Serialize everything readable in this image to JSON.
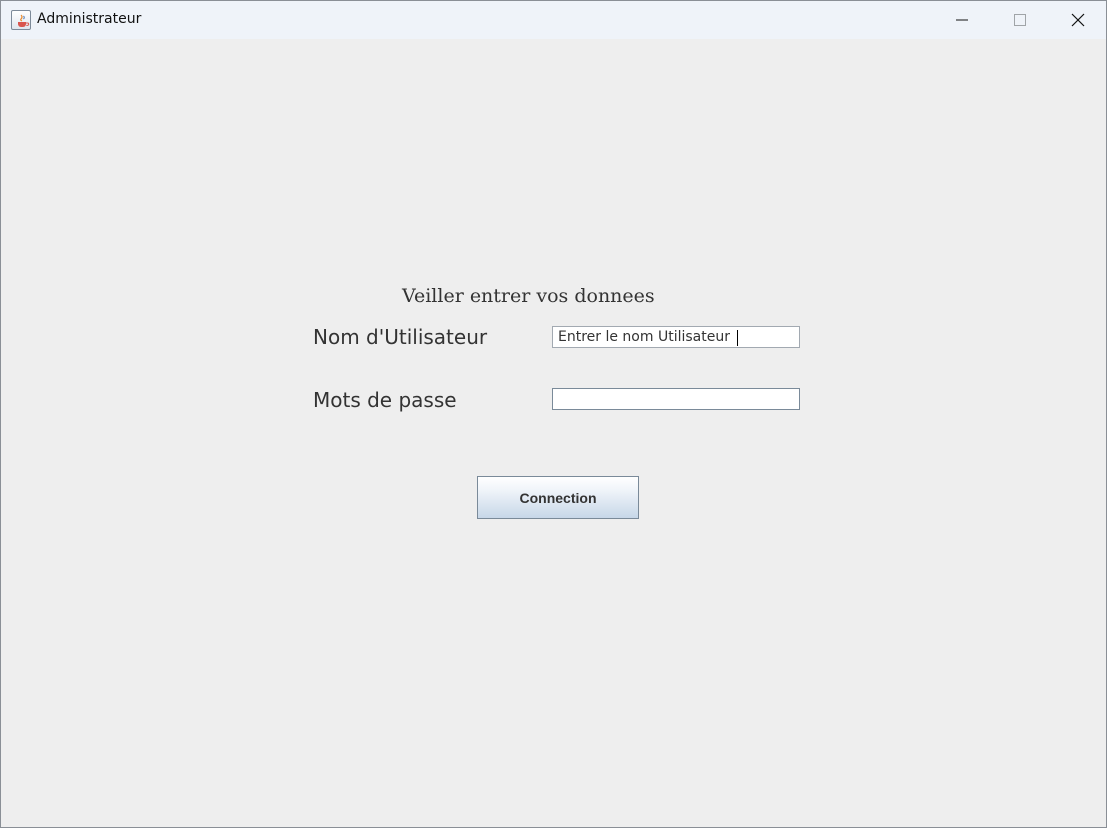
{
  "window": {
    "title": "Administrateur",
    "controls": {
      "minimize_icon": "minimize-icon",
      "maximize_icon": "maximize-icon",
      "close_icon": "close-icon"
    }
  },
  "form": {
    "heading": "Veiller entrer vos donnees",
    "username_label": "Nom d'Utilisateur",
    "username_value": "Entrer le nom Utilisateur",
    "password_label": "Mots de passe",
    "password_value": "",
    "submit_label": "Connection"
  },
  "colors": {
    "background": "#eeeeee",
    "titlebar": "#eff3f9",
    "button_gradient_bottom": "#c7d7e8",
    "text": "#333333"
  }
}
